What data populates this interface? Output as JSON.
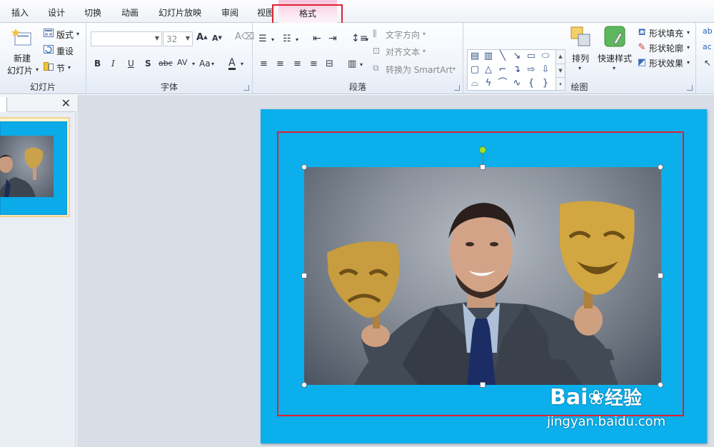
{
  "tabs": [
    {
      "label": "插入"
    },
    {
      "label": "设计"
    },
    {
      "label": "切换"
    },
    {
      "label": "动画"
    },
    {
      "label": "幻灯片放映"
    },
    {
      "label": "审阅"
    },
    {
      "label": "视图"
    },
    {
      "label": "格式"
    }
  ],
  "ribbon": {
    "slides": {
      "new_slide_line1": "新建",
      "new_slide_line2": "幻灯片",
      "layout": "版式",
      "reset": "重设",
      "section": "节",
      "group_label": "幻灯片"
    },
    "font": {
      "font_name": "",
      "font_size": "32",
      "group_label": "字体",
      "bold": "B",
      "italic": "I",
      "underline": "U",
      "shadow": "S",
      "strike": "abc",
      "spacing": "AV",
      "case": "Aa",
      "color": "A"
    },
    "paragraph": {
      "text_direction": "文字方向",
      "align_text": "对齐文本",
      "convert_smartart": "转换为 SmartArt",
      "group_label": "段落"
    },
    "drawing": {
      "arrange": "排列",
      "quick_styles": "快速样式",
      "shape_fill": "形状填充",
      "shape_outline": "形状轮廓",
      "shape_effects": "形状效果",
      "group_label": "绘图"
    }
  },
  "watermark": {
    "brand": "Bai",
    "brand_tail": "经验",
    "url": "jingyan.baidu.com"
  },
  "colors": {
    "slide_bg": "#0aafeb",
    "highlight_box": "#e02030",
    "format_tab": "#f6c3dd"
  }
}
